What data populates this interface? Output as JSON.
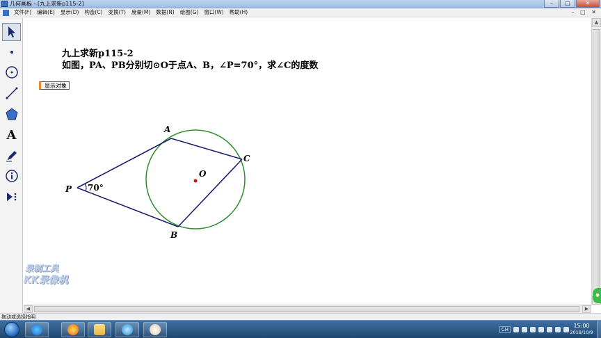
{
  "window": {
    "title": "几何画板 - [九上求新p115-2]",
    "controls": [
      "–",
      "□",
      "✕"
    ]
  },
  "menu": {
    "items": [
      "文件(F)",
      "编辑(E)",
      "显示(D)",
      "构造(C)",
      "变换(T)",
      "度量(M)",
      "数据(N)",
      "绘图(G)",
      "窗口(W)",
      "帮助(H)"
    ],
    "right_controls": "– □ ✕"
  },
  "toolbox": {
    "tools": [
      {
        "name": "arrow-tool",
        "icon": "arrow-icon",
        "selected": true
      },
      {
        "name": "point-tool",
        "icon": "point-icon"
      },
      {
        "name": "compass-tool",
        "icon": "circle-icon"
      },
      {
        "name": "straightedge-tool",
        "icon": "segment-icon"
      },
      {
        "name": "polygon-tool",
        "icon": "polygon-icon"
      },
      {
        "name": "text-tool",
        "icon": "text-icon",
        "glyph": "A"
      },
      {
        "name": "marker-tool",
        "icon": "pen-icon"
      },
      {
        "name": "information-tool",
        "icon": "info-icon"
      },
      {
        "name": "custom-tool",
        "icon": "custom-tool-icon"
      }
    ]
  },
  "canvas": {
    "problem_title": "九上求新p115-2",
    "problem_text": "如图，PA、PB分别切⊙O于点A、B，∠P=70°，求∠C的度数",
    "show_objects_button": "显示对象",
    "figure": {
      "labels": {
        "A": "A",
        "B": "B",
        "C": "C",
        "O": "O",
        "P": "P",
        "angle": "70°"
      },
      "line_color": "#1a1f6e",
      "circle_color": "#2e8b2e",
      "center_color": "#cc1111"
    },
    "watermark_line1": "录制工具",
    "watermark_line2": "KK录像机"
  },
  "statusbar": {
    "text": "拖动或选择指明"
  },
  "taskbar": {
    "tray_lang": "CH",
    "time": "15:00",
    "date": "2018/10/9"
  }
}
